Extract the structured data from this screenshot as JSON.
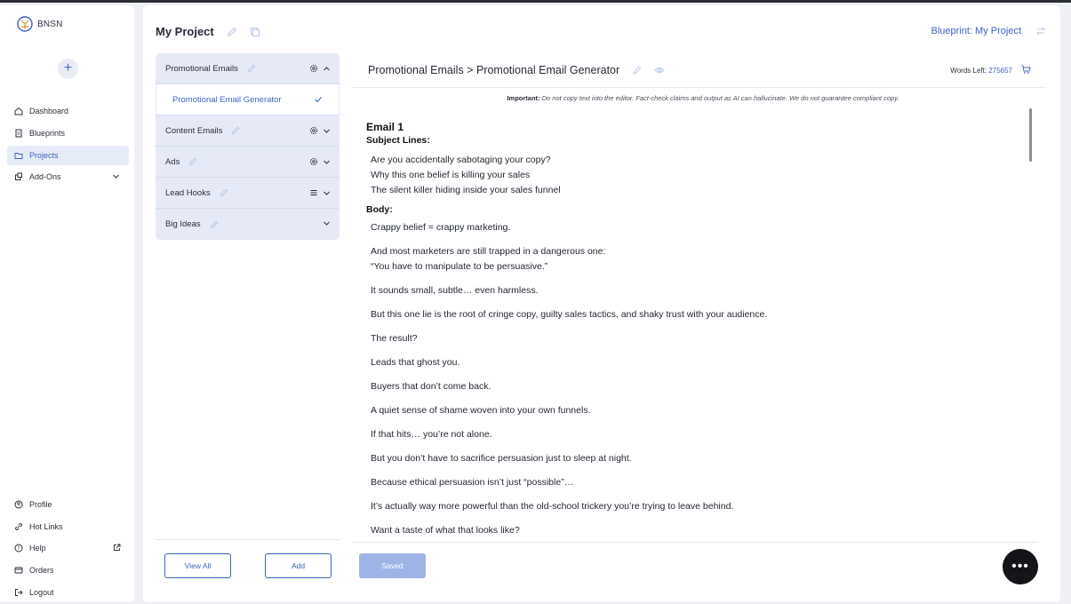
{
  "app": {
    "brand": "BNSN"
  },
  "sidebar": {
    "add_label": "+",
    "nav": [
      {
        "label": "Dashboard",
        "icon": "home-icon"
      },
      {
        "label": "Blueprints",
        "icon": "document-icon"
      },
      {
        "label": "Projects",
        "icon": "folder-icon",
        "active": true
      },
      {
        "label": "Add-Ons",
        "icon": "puzzle-icon"
      }
    ],
    "footer_nav": [
      {
        "label": "Profile",
        "icon": "user-icon"
      },
      {
        "label": "Hot Links",
        "icon": "link-icon"
      },
      {
        "label": "Help",
        "icon": "help-icon"
      },
      {
        "label": "Orders",
        "icon": "orders-icon"
      },
      {
        "label": "Logout",
        "icon": "logout-icon"
      }
    ]
  },
  "header": {
    "project_title": "My Project",
    "blueprint_label": "Blueprint: My Project"
  },
  "accordion": {
    "items": [
      {
        "label": "Promotional Emails",
        "expanded": true
      },
      {
        "label": "Content Emails"
      },
      {
        "label": "Ads"
      },
      {
        "label": "Lead Hooks"
      },
      {
        "label": "Big Ideas"
      }
    ],
    "sub_item": "Promotional Email Generator"
  },
  "buttons": {
    "view_all": "View All",
    "add": "Add",
    "saved": "Saved"
  },
  "editor": {
    "breadcrumb_parent": "Promotional Emails",
    "breadcrumb_sep": ">",
    "breadcrumb_child": "Promotional Email Generator",
    "words_left_label": "Words Left:",
    "words_left_value": "275657",
    "important_label": "Important:",
    "important_text": "Do not copy text into the editor. Fact-check claims and output as AI can hallucinate. We do not guarantee compliant copy.",
    "email_title": "Email 1",
    "subject_label": "Subject Lines:",
    "subject_lines": [
      "Are you accidentally sabotaging your copy?",
      "Why this one belief is killing your sales",
      "The silent killer hiding inside your sales funnel"
    ],
    "body_label": "Body:",
    "paragraphs": [
      "Crappy belief = crappy marketing.",
      "And most marketers are still trapped in a dangerous one:",
      "“You have to manipulate to be persuasive.”",
      "It sounds small, subtle… even harmless.",
      "But this one lie is the root of cringe copy, guilty sales tactics, and shaky trust with your audience.",
      "The result?",
      "Leads that ghost you.",
      "Buyers that don’t come back.",
      "A quiet sense of shame woven into your own funnels.",
      "If that hits… you’re not alone.",
      "But you don’t have to sacrifice persuasion just to sleep at night.",
      "Because ethical persuasion isn’t just “possible”…",
      "It’s actually way more powerful than the old-school trickery you’re trying to leave behind.",
      "Want a taste of what that looks like?"
    ]
  },
  "fab_label": "•••",
  "colors": {
    "accent": "#3d63c4",
    "accordion_bg": "#e6eaf7",
    "fab": "#121418"
  }
}
